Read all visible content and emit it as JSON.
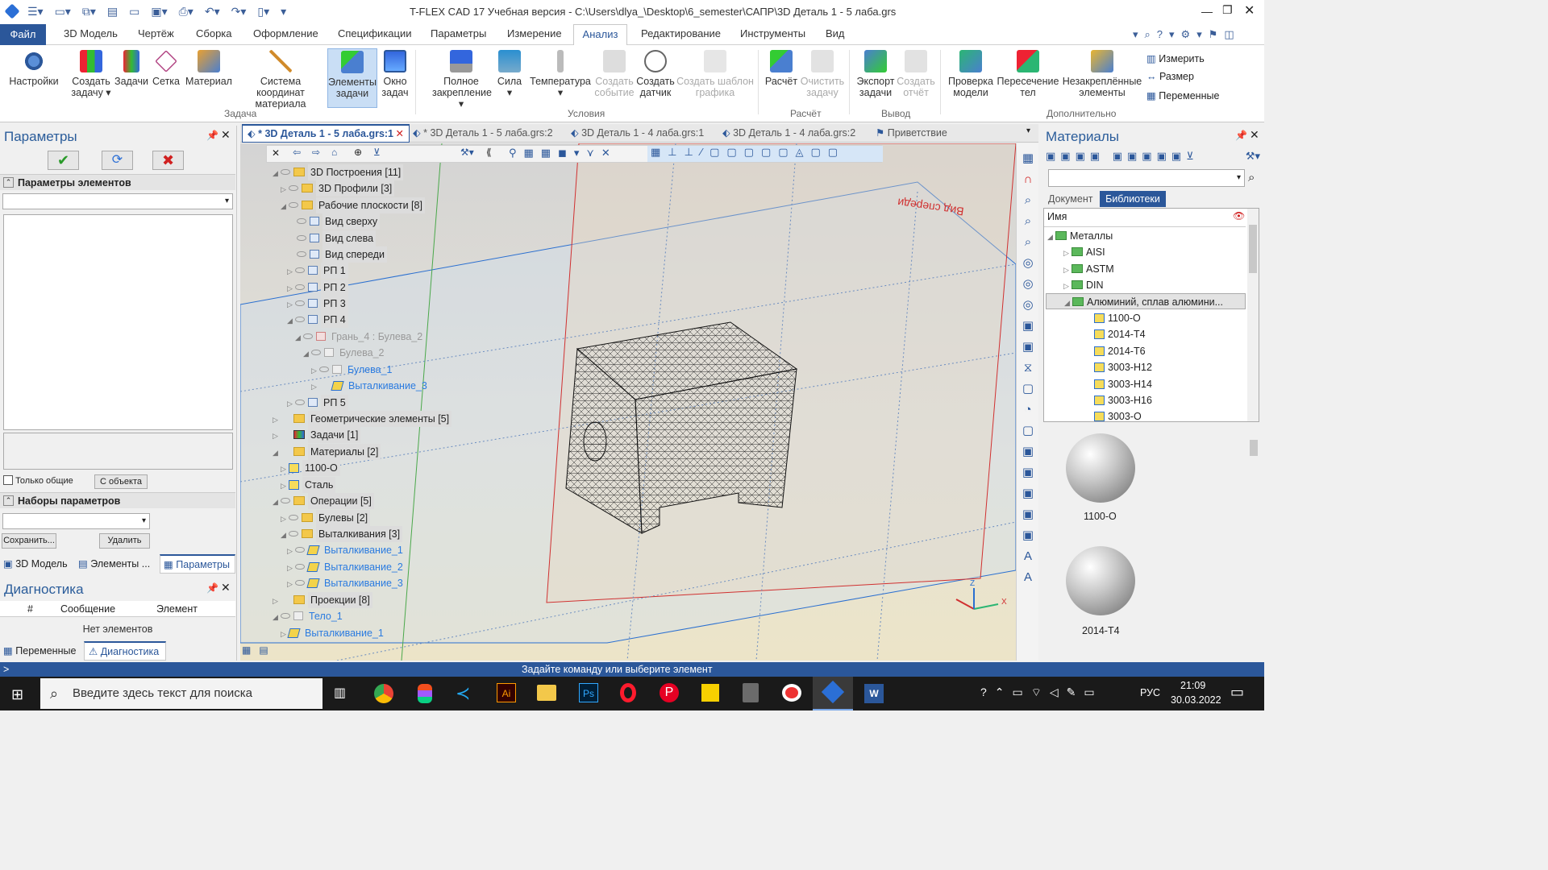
{
  "window": {
    "title": "T-FLEX CAD 17 Учебная версия - C:\\Users\\dlya_\\Desktop\\6_semester\\САПР\\3D Деталь 1 - 5 лаба.grs"
  },
  "ribbon_tabs": [
    "Файл",
    "3D Модель",
    "Чертёж",
    "Сборка",
    "Оформление",
    "Спецификации",
    "Параметры",
    "Измерение",
    "Анализ",
    "Редактирование",
    "Инструменты",
    "Вид"
  ],
  "ribbon": {
    "buttons": [
      "Настройки",
      "Создать задачу",
      "Задачи",
      "Сетка",
      "Материал",
      "Система координат материала",
      "Элементы задачи",
      "Окно задач",
      "Полное закрепление",
      "Сила",
      "Температура",
      "Создать событие",
      "Создать датчик",
      "Создать шаблон графика",
      "Расчёт",
      "Очистить задачу",
      "Экспорт задачи",
      "Создать отчёт",
      "Проверка модели",
      "Пересечение тел",
      "Незакреплённые элементы",
      "Измерить",
      "Размер",
      "Переменные"
    ],
    "groups": [
      "Задача",
      "Условия",
      "Расчёт",
      "Вывод",
      "Дополнительно"
    ]
  },
  "params_panel": {
    "title": "Параметры",
    "section1": "Параметры элементов",
    "only_common": "Только общие",
    "from_object": "С объекта",
    "section2": "Наборы параметров",
    "save": "Сохранить...",
    "delete": "Удалить",
    "tabs": [
      "3D Модель",
      "Элементы ...",
      "Параметры"
    ]
  },
  "diag_panel": {
    "title": "Диагностика",
    "cols": [
      "#",
      "Сообщение",
      "Элемент"
    ],
    "empty": "Нет элементов",
    "tabs": [
      "Переменные",
      "Диагностика"
    ]
  },
  "doc_tabs": [
    "* 3D Деталь 1 - 5 лаба.grs:1",
    "* 3D Деталь 1 - 5 лаба.grs:2",
    "3D Деталь 1 - 4 лаба.grs:1",
    "3D Деталь 1 - 4 лаба.grs:2",
    "Приветствие"
  ],
  "tree": [
    "3D Построения [11]",
    "3D Профили [3]",
    "Рабочие плоскости [8]",
    "Вид сверху",
    "Вид слева",
    "Вид спереди",
    "РП 1",
    "РП 2",
    "РП 3",
    "РП 4",
    "Грань_4 : Булева_2",
    "Булева_2",
    "Булева_1",
    "Выталкивание_3",
    "РП 5",
    "Геометрические элементы [5]",
    "Задачи [1]",
    "Материалы [2]",
    "1100-О",
    "Сталь",
    "Операции [5]",
    "Булевы [2]",
    "Выталкивания [3]",
    "Выталкивание_1",
    "Выталкивание_2",
    "Выталкивание_3",
    "Проекции [8]",
    "Тело_1",
    "Выталкивание_1"
  ],
  "viewport": {
    "plane_label": "Вид спереди"
  },
  "materials": {
    "title": "Материалы",
    "tabs": [
      "Документ",
      "Библиотеки"
    ],
    "col": "Имя",
    "rows": [
      "Металлы",
      "AISI",
      "ASTM",
      "DIN",
      "Алюминий, сплав алюмини...",
      "1100-O",
      "2014-T4",
      "2014-T6",
      "3003-H12",
      "3003-H14",
      "3003-H16",
      "3003-O"
    ],
    "previews": [
      "1100-O",
      "2014-T4"
    ]
  },
  "status": "Задайте команду или выберите элемент",
  "taskbar": {
    "search": "Введите здесь текст для поиска",
    "lang": "РУС",
    "time": "21:09",
    "date": "30.03.2022"
  },
  "colors": {
    "accent": "#2b579a",
    "selected": "#c9def5",
    "blue_text": "#2a7be0"
  }
}
